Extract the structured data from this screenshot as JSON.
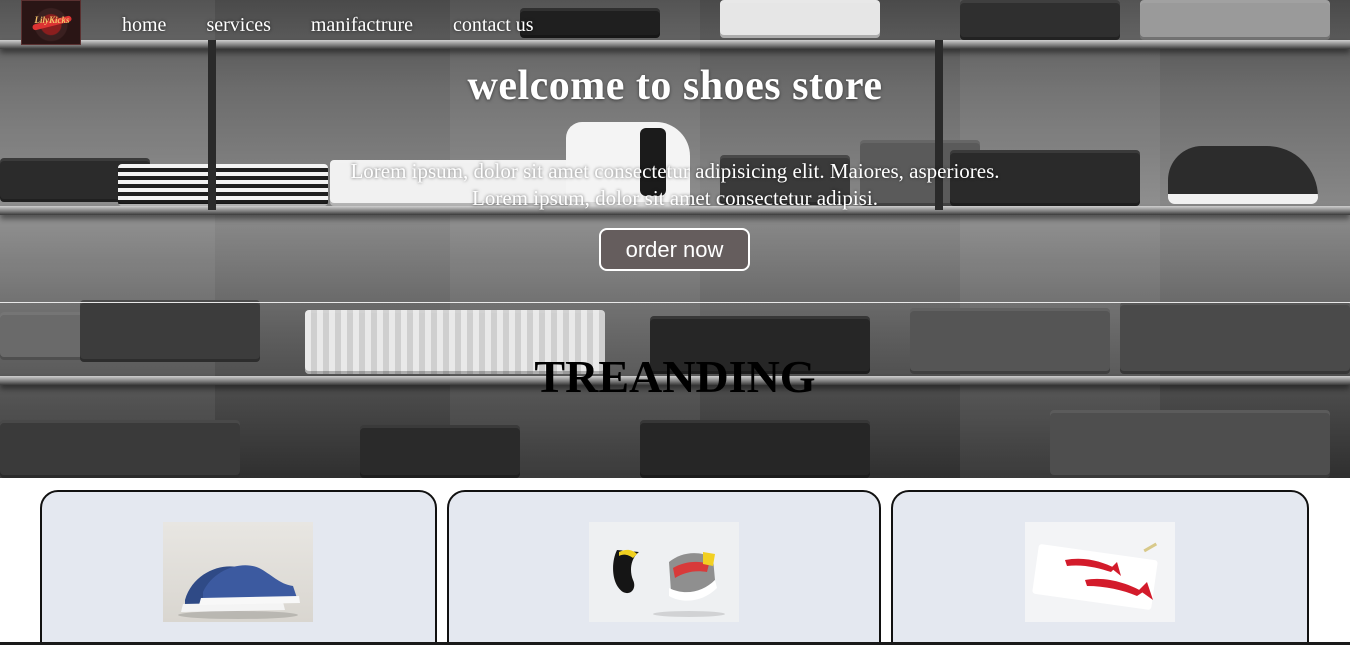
{
  "nav": {
    "logo_text": "LilyKicks",
    "links": [
      "home",
      "services",
      "manifactrure",
      "contact us"
    ]
  },
  "hero": {
    "title": "welcome to shoes store",
    "description_line1": "Lorem ipsum, dolor sit amet consectetur adipisicing elit. Maiores, asperiores.",
    "description_line2": "Lorem ipsum, dolor sit amet consectetur adipisi.",
    "button_label": "order now"
  },
  "trending": {
    "heading": "TREANDING",
    "cards": [
      {
        "title": "",
        "image": "blue-canvas-sneakers-icon"
      },
      {
        "title": "",
        "image": "floating-running-shoes-icon"
      },
      {
        "title": "",
        "image": "red-high-heels-icon"
      }
    ]
  },
  "colors": {
    "button_bg": "#655d5d",
    "card_bg": "#e4e8f0",
    "text_light": "#ffffff",
    "text_dark": "#000000"
  }
}
